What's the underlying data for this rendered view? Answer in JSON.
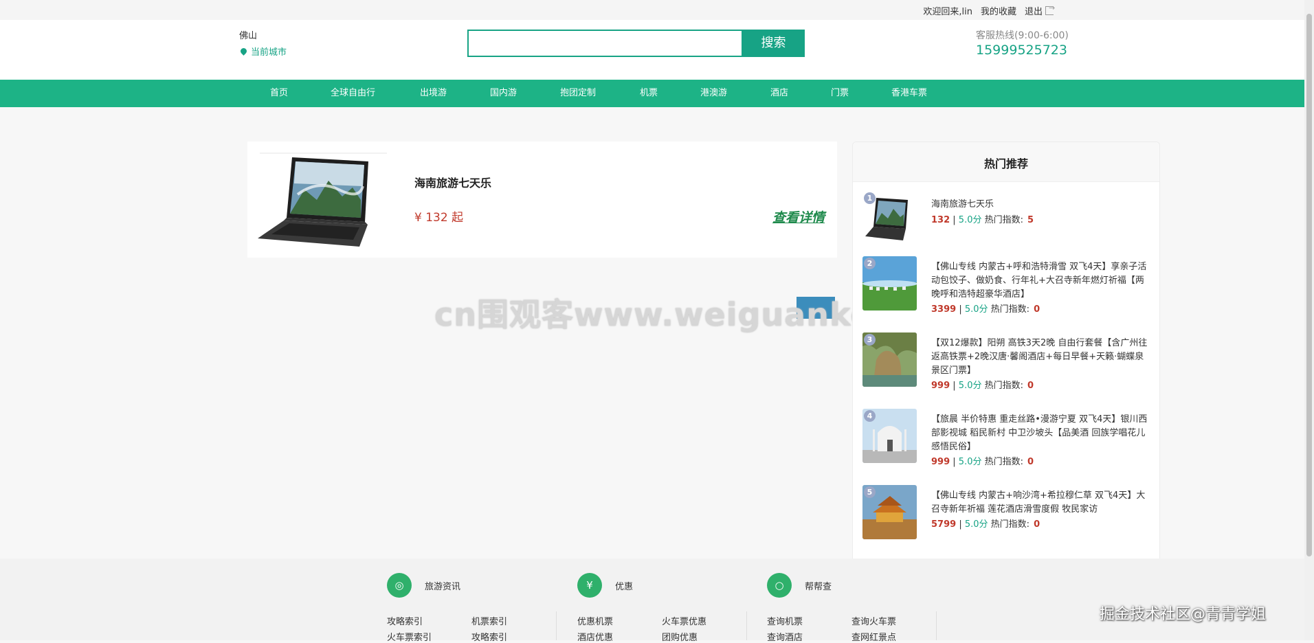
{
  "topbar": {
    "welcome": "欢迎回来,lin",
    "favorites": "我的收藏",
    "logout": "退出"
  },
  "header": {
    "city": "佛山",
    "city_switch": "当前城市",
    "search_value": "",
    "search_button": "搜索",
    "hotline_label": "客服热线(9:00-6:00)",
    "hotline_number": "15999525723"
  },
  "nav": {
    "items": [
      "首页",
      "全球自由行",
      "出境游",
      "国内游",
      "抱团定制",
      "机票",
      "港澳游",
      "酒店",
      "门票",
      "香港车票"
    ]
  },
  "result": {
    "title": "海南旅游七天乐",
    "price": "¥ 132 起",
    "detail_link": "查看详情"
  },
  "watermark": "cn围观客www.weiguanke.cn",
  "sidebar": {
    "title": "热门推荐",
    "items": [
      {
        "rank": "1",
        "name": "海南旅游七天乐",
        "price": "132",
        "score": "5.0分",
        "hot_label": "热门指数:",
        "hot": "5"
      },
      {
        "rank": "2",
        "name": "【佛山专线 内蒙古+呼和浩特滑雪 双飞4天】享亲子活动包饺子、做奶食、行年礼+大召寺新年燃灯祈福【两晚呼和浩特超豪华酒店】",
        "price": "3399",
        "score": "5.0分",
        "hot_label": "热门指数:",
        "hot": "0"
      },
      {
        "rank": "3",
        "name": "【双12爆款】阳朔 高铁3天2晚 自由行套餐【含广州往返高铁票+2晚汉唐·馨阁酒店+每日早餐+天籁·蝴蝶泉景区门票】",
        "price": "999",
        "score": "5.0分",
        "hot_label": "热门指数:",
        "hot": "0"
      },
      {
        "rank": "4",
        "name": "【旅晨 半价特惠 重走丝路•漫游宁夏 双飞4天】银川西部影视城 稻民新村 中卫沙坡头【品美酒 回族学唱花儿 感悟民俗】",
        "price": "999",
        "score": "5.0分",
        "hot_label": "热门指数:",
        "hot": "0"
      },
      {
        "rank": "5",
        "name": "【佛山专线 内蒙古+响沙湾+希拉穆仁草 双飞4天】大召寺新年祈福 莲花酒店滑雪度假 牧民家访",
        "price": "5799",
        "score": "5.0分",
        "hot_label": "热门指数:",
        "hot": "0"
      }
    ]
  },
  "footer": {
    "columns": [
      {
        "title": "旅游资讯",
        "icon": "balloon-icon",
        "links": [
          "攻略索引",
          "机票索引",
          "火车票索引",
          "攻略索引"
        ]
      },
      {
        "title": "优惠",
        "icon": "yen-icon",
        "links": [
          "优惠机票",
          "火车票优惠",
          "酒店优惠",
          "团购优惠"
        ]
      },
      {
        "title": "帮帮查",
        "icon": "search-icon",
        "links": [
          "查询机票",
          "查询火车票",
          "查询酒店",
          "查网红景点"
        ]
      }
    ]
  },
  "signature": "掘金技术社区@青青学姐",
  "colors": {
    "brand": "#1db386",
    "price": "#c0392b",
    "accent": "#17a385"
  }
}
